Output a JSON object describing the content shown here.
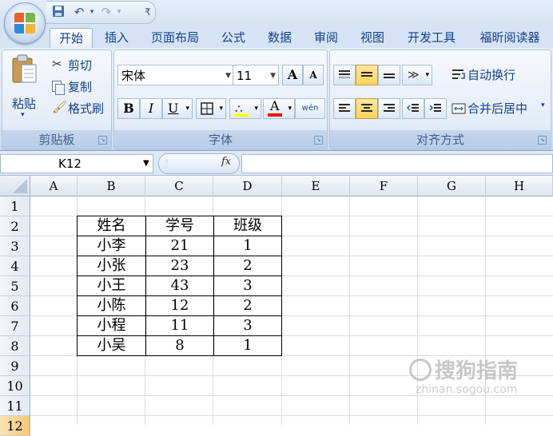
{
  "quick_access": {
    "save_icon": "save-icon",
    "undo_icon": "undo-icon",
    "redo_icon": "redo-icon",
    "customize_icon": "customize-icon"
  },
  "tabs": [
    "开始",
    "插入",
    "页面布局",
    "公式",
    "数据",
    "审阅",
    "视图",
    "开发工具",
    "福昕阅读器"
  ],
  "clipboard": {
    "paste": "粘贴",
    "cut": "剪切",
    "copy": "复制",
    "format_painter": "格式刷",
    "label": "剪贴板"
  },
  "font": {
    "name": "宋体",
    "size": "11",
    "bold": "B",
    "italic": "I",
    "underline": "U",
    "grow": "A",
    "shrink": "A",
    "font_color_letter": "A",
    "phonetic": "wén",
    "label": "字体"
  },
  "alignment": {
    "wrap": "自动换行",
    "merge": "合并后居中",
    "label": "对齐方式"
  },
  "formula_bar": {
    "name_box": "K12",
    "fx": "fx",
    "formula": ""
  },
  "columns": [
    "A",
    "B",
    "C",
    "D",
    "E",
    "F",
    "G",
    "H"
  ],
  "rows": [
    "1",
    "2",
    "3",
    "4",
    "5",
    "6",
    "7",
    "8",
    "9",
    "10",
    "11",
    "12"
  ],
  "table": {
    "headers": [
      "姓名",
      "学号",
      "班级"
    ],
    "rows": [
      [
        "小李",
        "21",
        "1"
      ],
      [
        "小张",
        "23",
        "2"
      ],
      [
        "小王",
        "43",
        "3"
      ],
      [
        "小陈",
        "12",
        "2"
      ],
      [
        "小程",
        "11",
        "3"
      ],
      [
        "小吴",
        "8",
        "1"
      ]
    ]
  },
  "watermark": {
    "text": "搜狗指南",
    "sub": "zhinan.sogou.com"
  },
  "colors": {
    "ribbon": "#dbe6f4",
    "accent": "#15428b",
    "highlight": "#ffd35c"
  }
}
